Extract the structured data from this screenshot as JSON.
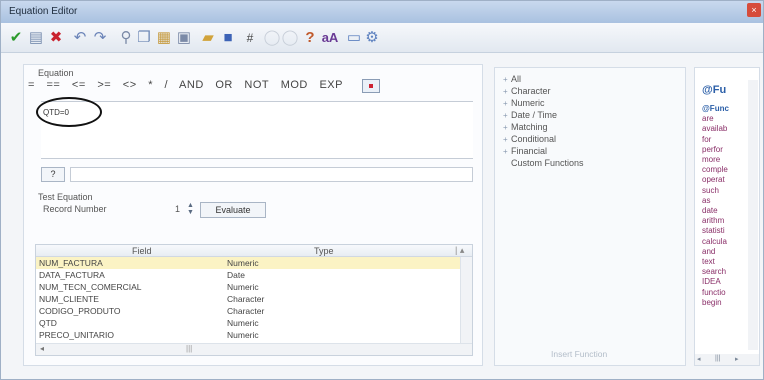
{
  "window": {
    "title": "Equation Editor"
  },
  "toolbar": {
    "icons": [
      "check-icon",
      "new-doc-icon",
      "delete-icon",
      "undo-icon",
      "redo-icon",
      "link-icon",
      "copy-icon",
      "paste-icon",
      "paste-special-icon",
      "open-folder-icon",
      "save-icon",
      "hash-icon",
      "circle-left-icon",
      "circle-right-icon",
      "help-icon",
      "font-icon",
      "window-icon",
      "gear-icon"
    ]
  },
  "equation": {
    "label": "Equation",
    "operators": [
      "=",
      "==",
      "<=",
      ">=",
      "<>",
      "*",
      "/",
      "AND",
      "OR",
      "NOT",
      "MOD",
      "EXP"
    ],
    "text": "QTD=0"
  },
  "help_button": {
    "label": "?"
  },
  "test": {
    "label": "Test Equation",
    "record_label": "Record Number",
    "record_value": "1",
    "evaluate_label": "Evaluate"
  },
  "fields_table": {
    "columns": [
      "Field",
      "Type"
    ],
    "rows": [
      {
        "field": "NUM_FACTURA",
        "type": "Numeric"
      },
      {
        "field": "DATA_FACTURA",
        "type": "Date"
      },
      {
        "field": "NUM_TECN_COMERCIAL",
        "type": "Numeric"
      },
      {
        "field": "NUM_CLIENTE",
        "type": "Character"
      },
      {
        "field": "CODIGO_PRODUTO",
        "type": "Character"
      },
      {
        "field": "QTD",
        "type": "Numeric"
      },
      {
        "field": "PRECO_UNITARIO",
        "type": "Numeric"
      }
    ]
  },
  "function_tree": {
    "items": [
      "All",
      "Character",
      "Numeric",
      "Date / Time",
      "Matching",
      "Conditional",
      "Financial",
      "Custom Functions"
    ],
    "insert_label": "Insert Function"
  },
  "help_panel": {
    "title": "@Fu",
    "body": [
      "@Func",
      "are",
      "availab",
      "for",
      "perfor",
      "more",
      "comple",
      "operat",
      "such",
      "as",
      "date",
      "arithm",
      "statisti",
      "calcula",
      "and",
      "text",
      "search",
      "IDEA",
      "functio",
      "begin"
    ]
  }
}
